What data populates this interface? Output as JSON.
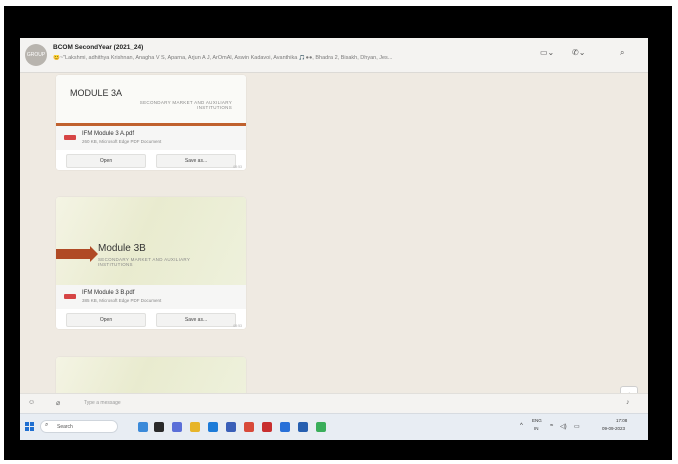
{
  "header": {
    "avatar_text": "GROUP",
    "title": "BCOM SecondYear (2021_24)",
    "members": "😊~\"Lakshmi, adhithya Krishnan, Anagha V S, Aparna, Arjun A J, ArOmAl, Aswin Kadavoi, Avanthika 🎵●●, Bhadra 2, Bisakh, Dhyan, Jes..."
  },
  "chat": {
    "messages": [
      {
        "preview_title": "MODULE 3A",
        "preview_subtitle": "SECONDARY MARKET AND AUXILIARY INSTITUTIONS",
        "file_name": "IFM Module 3 A.pdf",
        "file_meta": "260 KB, Microsoft Edge PDF Document",
        "open_label": "Open",
        "save_label": "Save as...",
        "time": "08:53"
      },
      {
        "preview_title": "Module 3B",
        "preview_subtitle": "SECONDARY MARKET AND AUXILIARY INSTITUTIONS",
        "file_name": "IFM Module 3 B.pdf",
        "file_meta": "385 KB, Microsoft Edge PDF Document",
        "open_label": "Open",
        "save_label": "Save as...",
        "time": "08:53"
      }
    ]
  },
  "compose": {
    "placeholder": "Type a message"
  },
  "taskbar": {
    "search_label": "Search",
    "lang_top": "ENG",
    "lang_bottom": "IN",
    "time": "17:08",
    "date": "09-09-2023"
  },
  "colors": {
    "accent": "#c0612e",
    "taskbar_blue": "#1f6fd1"
  }
}
